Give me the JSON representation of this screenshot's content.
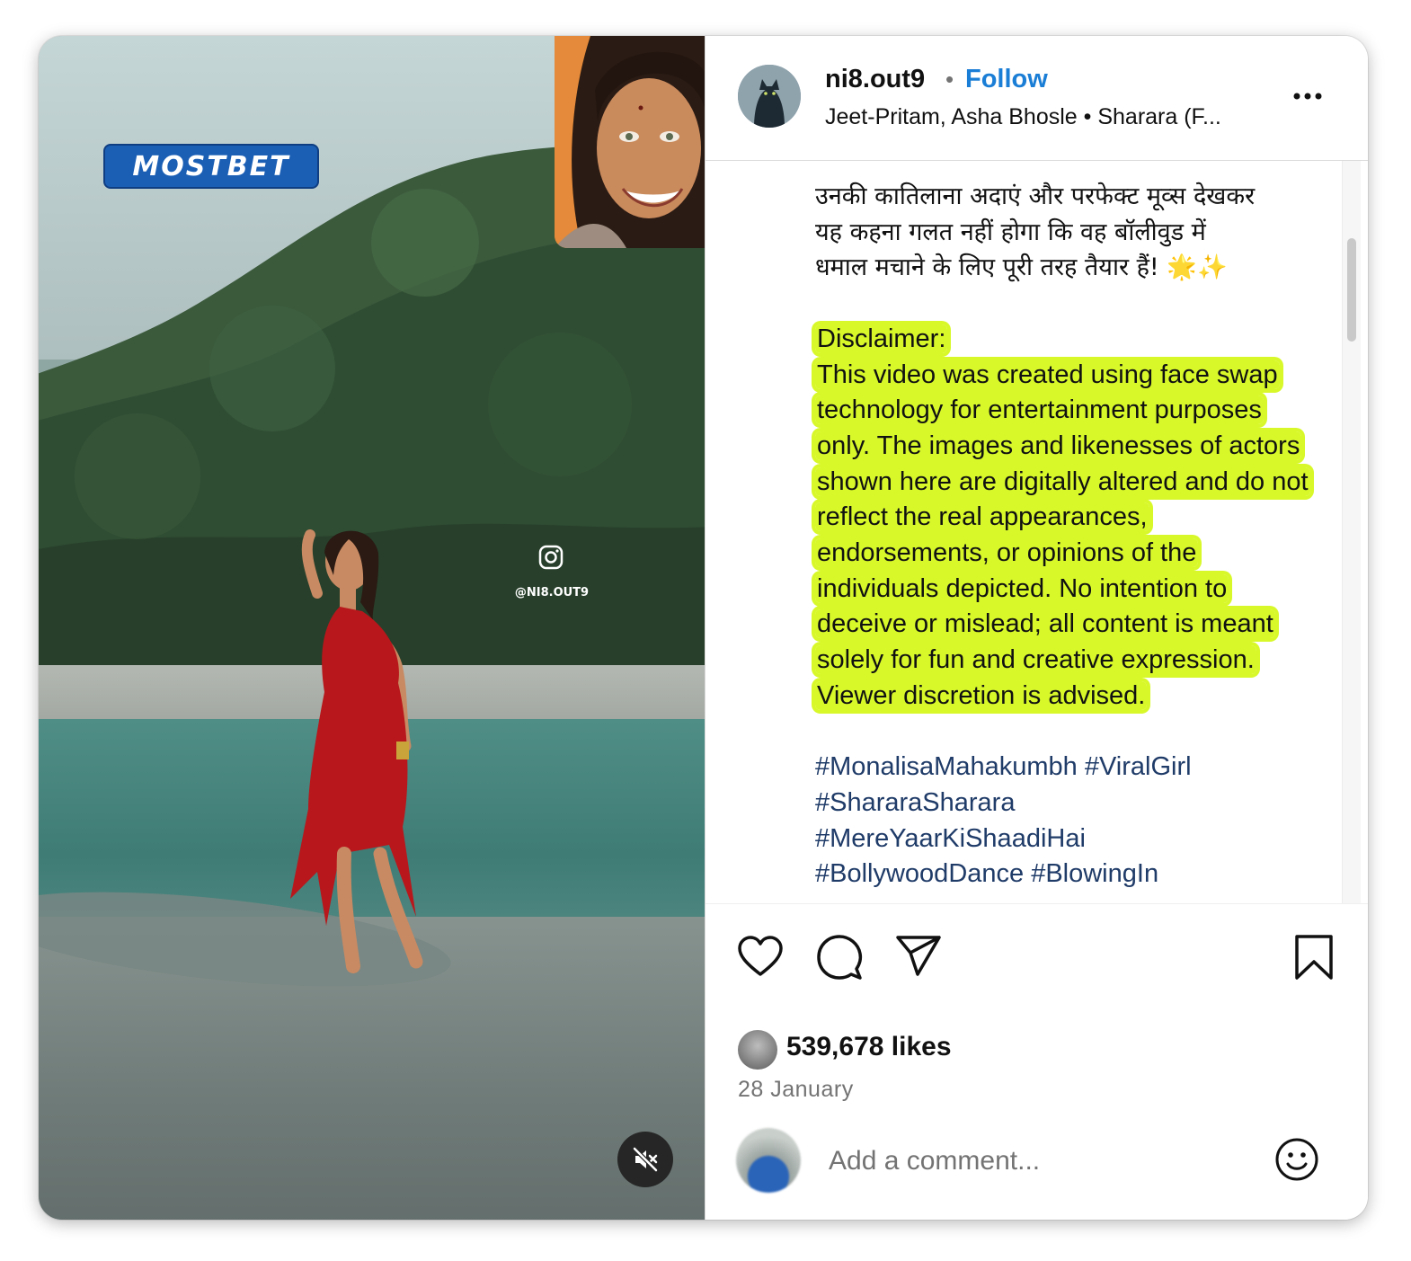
{
  "media": {
    "brand_logo": "MOSTBET",
    "watermark": "@NI8.OUT9"
  },
  "post": {
    "username": "ni8.out9",
    "separator": "•",
    "follow_label": "Follow",
    "audio": "Jeet-Pritam, Asha Bhosle • Sharara (F...",
    "caption": {
      "hindi_lines": [
        "उनकी कातिलाना अदाएं और परफेक्ट मूव्स देखकर",
        "यह कहना गलत नहीं होगा कि वह बॉलीवुड में",
        "धमाल मचाने के लिए पूरी तरह तैयार हैं! 🌟✨"
      ],
      "disclaimer_title": "Disclaimer:",
      "disclaimer_body": "This video was created using face swap technology for entertainment purposes only. The images and likenesses of actors shown here are digitally altered and do not reflect the real appearances, endorsements, or opinions of the individuals depicted. No intention to deceive or mislead; all content is meant solely for fun and creative expression. Viewer discretion is advised.",
      "hashtag_lines": [
        "#MonalisaMahakumbh #ViralGirl",
        "#ShararaSharara",
        "#MereYaarKiShaadiHai",
        "#BollywoodDance #BlowingIn"
      ]
    },
    "likes": "539,678 likes",
    "date": "28 January",
    "comment_placeholder": "Add a comment..."
  },
  "colors": {
    "follow": "#1b7ed6",
    "highlight": "#d8f82a",
    "hashtag": "#1f3b68",
    "dress": "#c0191c"
  },
  "icons": [
    "heart-icon",
    "comment-icon",
    "share-icon",
    "bookmark-icon",
    "more-options-icon",
    "muted-speaker-icon",
    "emoji-icon",
    "instagram-icon"
  ]
}
